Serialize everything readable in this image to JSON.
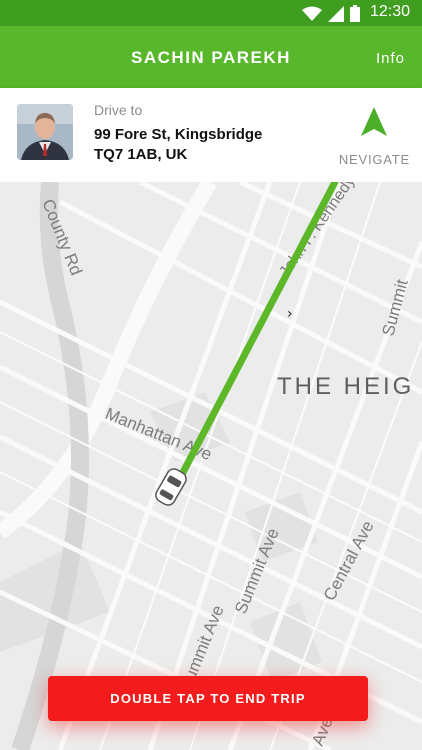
{
  "status_bar": {
    "time": "12:30",
    "icons": [
      "wifi-icon",
      "signal-icon",
      "battery-icon"
    ]
  },
  "app_bar": {
    "title": "SACHIN PAREKH",
    "info_label": "Info",
    "color": "#58b72b"
  },
  "trip_card": {
    "drive_label": "Drive to",
    "address_line1": "99 Fore St, Kingsbridge",
    "address_line2": "TQ7 1AB, UK",
    "navigate_label": "NEVIGATE"
  },
  "map": {
    "labels": {
      "county_rd": "County Rd",
      "john_f_kennedy": "John F. Kennedy",
      "summit": "Summit",
      "the_heights": "THE HEIG",
      "manhattan_ave": "Manhattan Ave",
      "central_ave": "Central Ave",
      "summit_ave": "Summit Ave",
      "ave_bottom": "Ave"
    },
    "route_color": "#5cb829"
  },
  "end_trip": {
    "label": "DOUBLE TAP TO END TRIP",
    "color": "#f31b1b"
  }
}
